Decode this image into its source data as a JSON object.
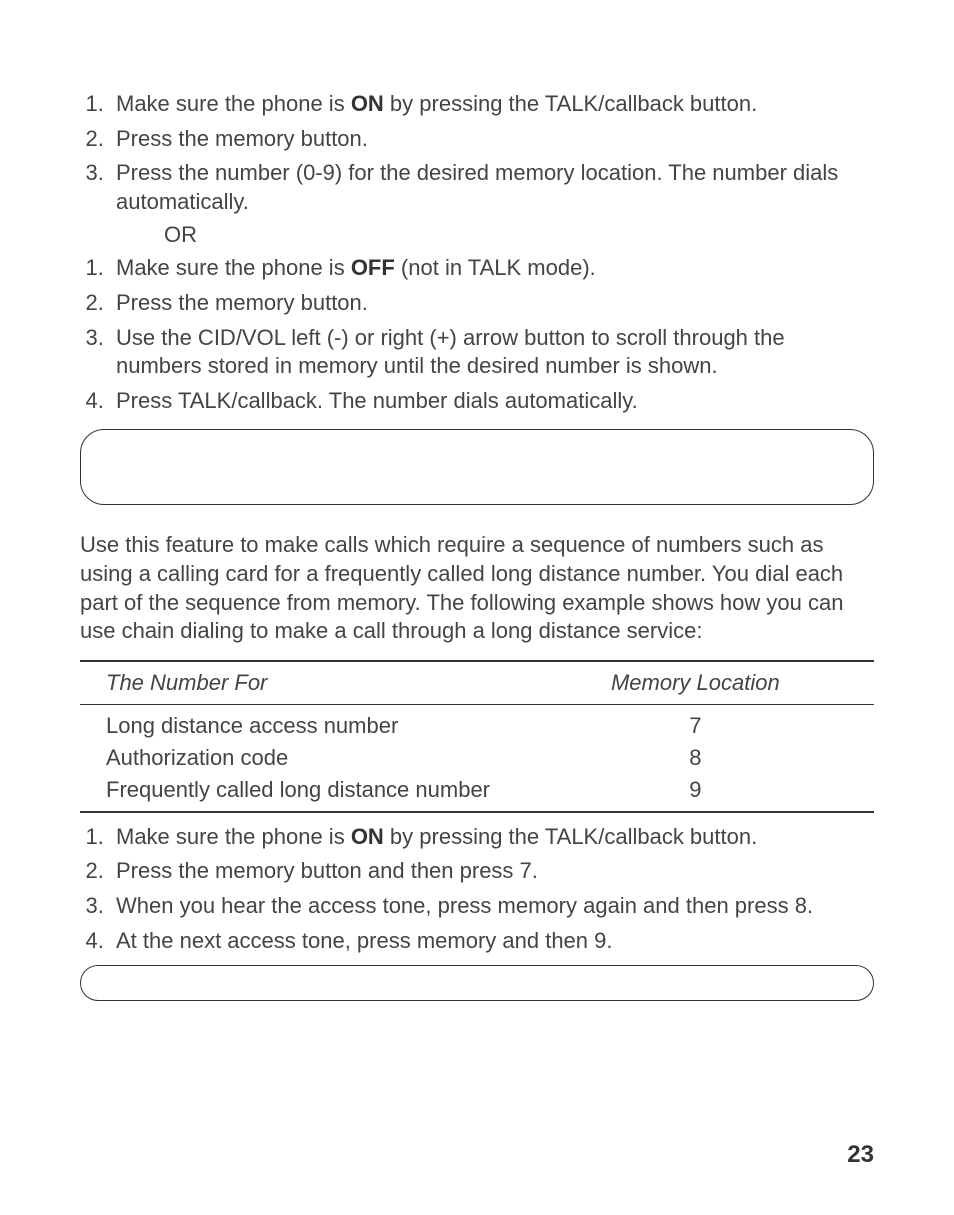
{
  "list1": {
    "i1_pre": "Make sure the phone is ",
    "i1_bold": "ON",
    "i1_post": " by pressing the TALK/callback button.",
    "i2": "Press the memory button.",
    "i3": "Press the number (0-9) for the desired memory location. The number dials automatically."
  },
  "or": "OR",
  "list2": {
    "i1_pre": "Make sure the phone is ",
    "i1_bold": "OFF",
    "i1_post": " (not in TALK mode).",
    "i2": "Press the memory button.",
    "i3": "Use the CID/VOL left (-) or right (+) arrow button to scroll through the numbers stored in memory until the desired number is shown.",
    "i4": "Press TALK/callback. The number dials automatically."
  },
  "chain_intro": "Use this feature to make calls which require a sequence of numbers such as using a calling card for a frequently called long distance number. You dial each part of the sequence from memory. The following example shows how you can use chain dialing to make a call through a long distance service:",
  "table": {
    "header1": "The Number For",
    "header2": "Memory Location",
    "rows": {
      "r1": {
        "c1": "Long distance access number",
        "c2": "7"
      },
      "r2": {
        "c1": "Authorization code",
        "c2": "8"
      },
      "r3": {
        "c1": "Frequently called long distance number",
        "c2": "9"
      }
    }
  },
  "list3": {
    "i1_pre": "Make sure the phone is ",
    "i1_bold": "ON",
    "i1_post": " by pressing the TALK/callback button.",
    "i2": "Press the memory button and then press 7.",
    "i3": "When you hear the access tone, press memory again and then press 8.",
    "i4": "At the next access tone, press memory and then 9."
  },
  "page_number": "23"
}
